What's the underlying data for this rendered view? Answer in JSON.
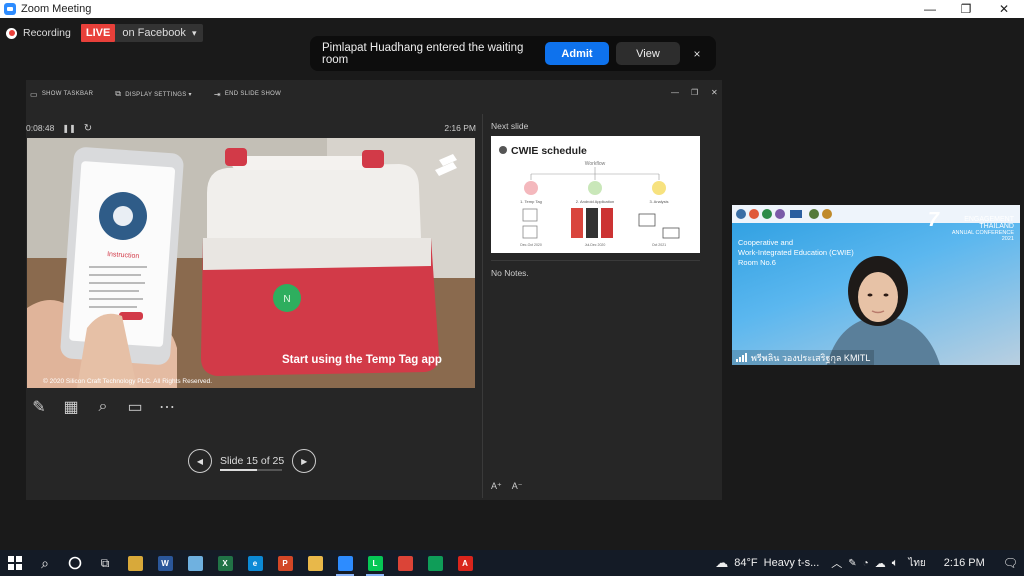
{
  "window": {
    "title": "Zoom Meeting",
    "controls": [
      "—",
      "❐",
      "✕"
    ]
  },
  "recording": {
    "label": "Recording",
    "live_badge": "LIVE",
    "destination": "on Facebook",
    "caret": "▾"
  },
  "notification": {
    "message": "Pimlapat Huadhang entered the waiting room",
    "admit_label": "Admit",
    "view_label": "View",
    "close_glyph": "×"
  },
  "presenter_toolbar": {
    "show_taskbar": "SHOW TASKBAR",
    "display_settings": "DISPLAY SETTINGS ▾",
    "end_slide_show": "END SLIDE SHOW"
  },
  "presenter": {
    "elapsed": "0:08:48",
    "clock": "2:16 PM",
    "next_slide_label": "Next slide",
    "notes": "No Notes.",
    "slide_counter": "Slide 15 of 25",
    "progress_fraction": 0.6,
    "font_larger": "A⁺",
    "font_smaller": "A⁻"
  },
  "current_slide": {
    "caption": "Start using the Temp Tag app",
    "copyright": "© 2020 Silicon Craft Technology PLC. All Rights Reserved.",
    "phone_heading": "Instruction",
    "cooler_tag_letter": "N"
  },
  "next_slide": {
    "title": "CWIE schedule",
    "workflow_label": "Workflow",
    "steps": [
      "1. Temp Tag",
      "2. Android Application",
      "3. Analysis"
    ],
    "dates": [
      "Dec-Oct 2020",
      "Jul-Dec 2020",
      "Oct 2021"
    ]
  },
  "video": {
    "banner_line1": "Cooperative and",
    "banner_line2": "Work-Integrated Education (CWIE)",
    "banner_line3": "Room No.6",
    "conf_number": "7",
    "conf_line1": "ENGAGEMENT THAILAND",
    "conf_line2": "ANNUAL CONFERENCE 2021",
    "participant_name": "พรีพลิน วองประเสริฐกุล KMITL"
  },
  "taskbar": {
    "weather_temp": "84°F",
    "weather_text": "Heavy t-s...",
    "language": "ไทย",
    "time": "2:16 PM",
    "apps": [
      {
        "icon": "file-explorer-icon",
        "letter": "",
        "color": "#d8a93a"
      },
      {
        "icon": "word-icon",
        "letter": "W",
        "color": "#2b579a"
      },
      {
        "icon": "notepad-icon",
        "letter": "",
        "color": "#6fb1e0"
      },
      {
        "icon": "excel-icon",
        "letter": "X",
        "color": "#217346"
      },
      {
        "icon": "edge-icon",
        "letter": "e",
        "color": "#0c8ad6"
      },
      {
        "icon": "powerpoint-icon",
        "letter": "P",
        "color": "#d24726"
      },
      {
        "icon": "folder-icon",
        "letter": "",
        "color": "#e8b84a"
      },
      {
        "icon": "zoom-icon",
        "letter": "",
        "color": "#2d8cff"
      },
      {
        "icon": "line-icon",
        "letter": "L",
        "color": "#06c755"
      },
      {
        "icon": "chrome-icon",
        "letter": "",
        "color": "#db4437"
      },
      {
        "icon": "chrome-profile-icon",
        "letter": "",
        "color": "#0f9d58"
      },
      {
        "icon": "acrobat-icon",
        "letter": "A",
        "color": "#d9251c"
      }
    ]
  }
}
